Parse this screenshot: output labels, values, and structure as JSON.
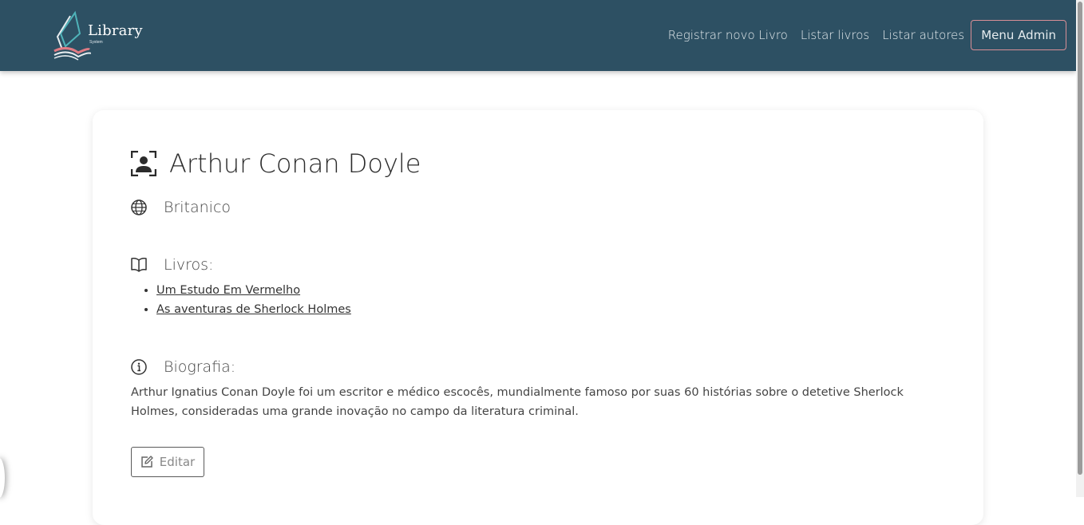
{
  "navbar": {
    "logo_text": "Library",
    "logo_subtext": "System",
    "links": [
      "Registrar novo Livro",
      "Listar livros",
      "Listar autores"
    ],
    "admin_button": "Menu Admin"
  },
  "author": {
    "name": "Arthur Conan Doyle",
    "nationality": "Britanico",
    "books_label": "Livros:",
    "books": [
      "Um Estudo Em Vermelho",
      "As aventuras de Sherlock Holmes"
    ],
    "bio_label": "Biografia:",
    "bio": "Arthur Ignatius Conan Doyle foi um escritor e médico escocês, mundialmente famoso por suas 60 histórias sobre o detetive Sherlock Holmes, consideradas uma grande inovação no campo da literatura criminal.",
    "edit_button": "Editar"
  },
  "colors": {
    "navbar_bg": "#2d5063",
    "admin_border": "#d98f96"
  }
}
